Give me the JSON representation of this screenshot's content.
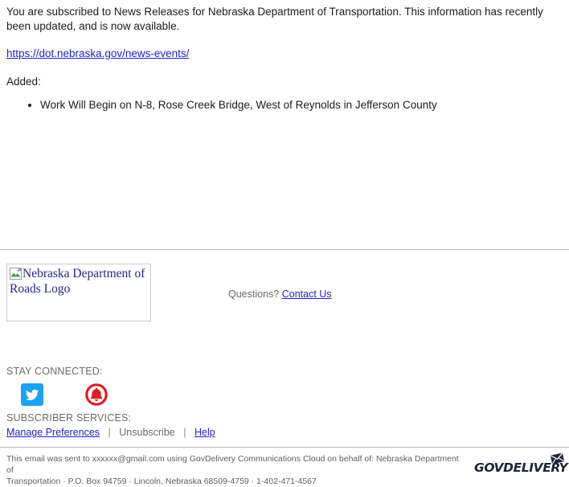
{
  "message": {
    "intro": "You are subscribed to News Releases for Nebraska Department of Transportation. This information has recently been updated, and is now available.",
    "link_url": "https://dot.nebraska.gov/news-events/",
    "added_label": "Added:",
    "added_items": [
      "Work Will Begin on N-8, Rose Creek Bridge, West of Reynolds in Jefferson County"
    ]
  },
  "logo": {
    "alt_text": "Nebraska Department of Roads Logo"
  },
  "questions": {
    "label": "Questions?",
    "link_label": "Contact Us"
  },
  "stay_connected": {
    "caption": "STAY CONNECTED:",
    "icons": [
      {
        "name": "twitter-icon",
        "color": "#1da1f2"
      },
      {
        "name": "bell-icon",
        "color": "#d91f26"
      }
    ]
  },
  "subscriber_services": {
    "caption": "SUBSCRIBER SERVICES:",
    "manage_label": "Manage Preferences",
    "unsubscribe_label": "Unsubscribe",
    "help_label": "Help",
    "separator": "|"
  },
  "footer": {
    "line1": "This email was sent to xxxxxx@gmail.com using GovDelivery Communications Cloud on behalf of: Nebraska Department of",
    "line2": "Transportation · P.O. Box 94759 · Lincoln, Nebraska 68509-4759 · 1-402-471-4567",
    "brand": "GOVDELIVERY"
  },
  "colors": {
    "link": "#2222cc",
    "muted_text": "#6a6a6a",
    "rule": "#b9b9b9",
    "alt_text": "#26248c",
    "brand_dark": "#23243a"
  }
}
